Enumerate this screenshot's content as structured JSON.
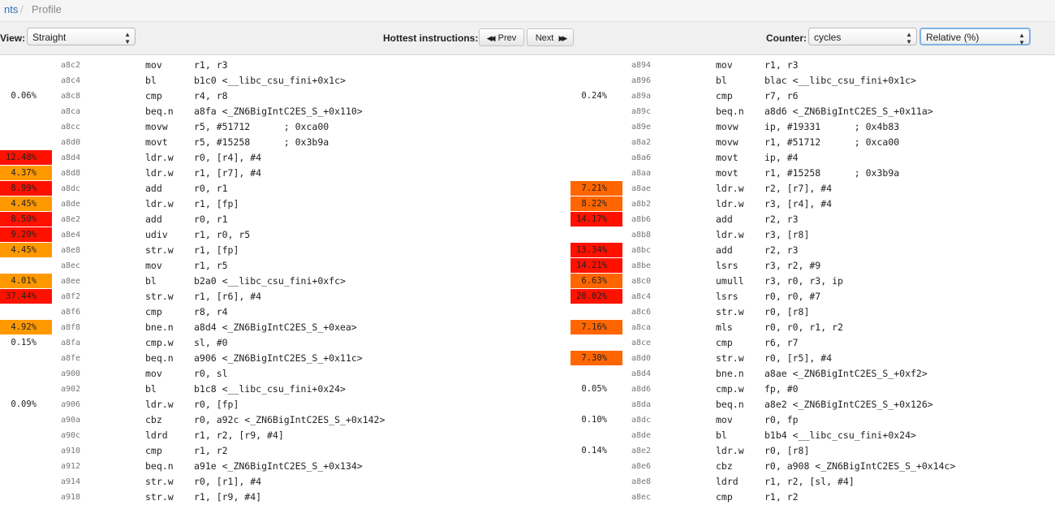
{
  "breadcrumb": {
    "parent": "nts",
    "separator": "/",
    "current": "Profile"
  },
  "toolbar": {
    "view_label": "View:",
    "view_value": "Straight",
    "hottest_label": "Hottest instructions:",
    "prev_label": "Prev",
    "next_label": "Next",
    "counter_label": "Counter:",
    "counter_value": "cycles",
    "mode_value": "Relative (%)"
  },
  "colors": {
    "hot": "#ff1100",
    "warm": "#ff6600",
    "mild": "#ff9900",
    "link": "#2a6fb8"
  },
  "left": [
    {
      "pct": "",
      "heat": "",
      "addr": "a8c2",
      "mn": "mov",
      "ops": "r1, r3"
    },
    {
      "pct": "",
      "heat": "",
      "addr": "a8c4",
      "mn": "bl",
      "ops": "b1c0 <__libc_csu_fini+0x1c>"
    },
    {
      "pct": "0.06%",
      "heat": "",
      "addr": "a8c8",
      "mn": "cmp",
      "ops": "r4, r8"
    },
    {
      "pct": "",
      "heat": "",
      "addr": "a8ca",
      "mn": "beq.n",
      "ops": "a8fa <_ZN6BigIntC2ES_S_+0x110>"
    },
    {
      "pct": "",
      "heat": "",
      "addr": "a8cc",
      "mn": "movw",
      "ops": "r5, #51712      ; 0xca00"
    },
    {
      "pct": "",
      "heat": "",
      "addr": "a8d0",
      "mn": "movt",
      "ops": "r5, #15258      ; 0x3b9a"
    },
    {
      "pct": "12.48%",
      "heat": "h1",
      "addr": "a8d4",
      "mn": "ldr.w",
      "ops": "r0, [r4], #4"
    },
    {
      "pct": "4.37%",
      "heat": "h3",
      "addr": "a8d8",
      "mn": "ldr.w",
      "ops": "r1, [r7], #4"
    },
    {
      "pct": "8.99%",
      "heat": "h1",
      "addr": "a8dc",
      "mn": "add",
      "ops": "r0, r1"
    },
    {
      "pct": "4.45%",
      "heat": "h3",
      "addr": "a8de",
      "mn": "ldr.w",
      "ops": "r1, [fp]"
    },
    {
      "pct": "8.50%",
      "heat": "h1",
      "addr": "a8e2",
      "mn": "add",
      "ops": "r0, r1"
    },
    {
      "pct": "9.20%",
      "heat": "h1",
      "addr": "a8e4",
      "mn": "udiv",
      "ops": "r1, r0, r5"
    },
    {
      "pct": "4.45%",
      "heat": "h3",
      "addr": "a8e8",
      "mn": "str.w",
      "ops": "r1, [fp]"
    },
    {
      "pct": "",
      "heat": "",
      "addr": "a8ec",
      "mn": "mov",
      "ops": "r1, r5"
    },
    {
      "pct": "4.01%",
      "heat": "h3",
      "addr": "a8ee",
      "mn": "bl",
      "ops": "b2a0 <__libc_csu_fini+0xfc>"
    },
    {
      "pct": "37.44%",
      "heat": "h1",
      "addr": "a8f2",
      "mn": "str.w",
      "ops": "r1, [r6], #4"
    },
    {
      "pct": "",
      "heat": "",
      "addr": "a8f6",
      "mn": "cmp",
      "ops": "r8, r4"
    },
    {
      "pct": "4.92%",
      "heat": "h3",
      "addr": "a8f8",
      "mn": "bne.n",
      "ops": "a8d4 <_ZN6BigIntC2ES_S_+0xea>"
    },
    {
      "pct": "0.15%",
      "heat": "",
      "addr": "a8fa",
      "mn": "cmp.w",
      "ops": "sl, #0"
    },
    {
      "pct": "",
      "heat": "",
      "addr": "a8fe",
      "mn": "beq.n",
      "ops": "a906 <_ZN6BigIntC2ES_S_+0x11c>"
    },
    {
      "pct": "",
      "heat": "",
      "addr": "a900",
      "mn": "mov",
      "ops": "r0, sl"
    },
    {
      "pct": "",
      "heat": "",
      "addr": "a902",
      "mn": "bl",
      "ops": "b1c8 <__libc_csu_fini+0x24>"
    },
    {
      "pct": "0.09%",
      "heat": "",
      "addr": "a906",
      "mn": "ldr.w",
      "ops": "r0, [fp]"
    },
    {
      "pct": "",
      "heat": "",
      "addr": "a90a",
      "mn": "cbz",
      "ops": "r0, a92c <_ZN6BigIntC2ES_S_+0x142>"
    },
    {
      "pct": "",
      "heat": "",
      "addr": "a90c",
      "mn": "ldrd",
      "ops": "r1, r2, [r9, #4]"
    },
    {
      "pct": "",
      "heat": "",
      "addr": "a910",
      "mn": "cmp",
      "ops": "r1, r2"
    },
    {
      "pct": "",
      "heat": "",
      "addr": "a912",
      "mn": "beq.n",
      "ops": "a91e <_ZN6BigIntC2ES_S_+0x134>"
    },
    {
      "pct": "",
      "heat": "",
      "addr": "a914",
      "mn": "str.w",
      "ops": "r0, [r1], #4"
    },
    {
      "pct": "",
      "heat": "",
      "addr": "a918",
      "mn": "str.w",
      "ops": "r1, [r9, #4]"
    }
  ],
  "right": [
    {
      "pct": "",
      "heat": "",
      "addr": "a894",
      "mn": "mov",
      "ops": "r1, r3"
    },
    {
      "pct": "",
      "heat": "",
      "addr": "a896",
      "mn": "bl",
      "ops": "blac <__libc_csu_fini+0x1c>"
    },
    {
      "pct": "0.24%",
      "heat": "",
      "addr": "a89a",
      "mn": "cmp",
      "ops": "r7, r6"
    },
    {
      "pct": "",
      "heat": "",
      "addr": "a89c",
      "mn": "beq.n",
      "ops": "a8d6 <_ZN6BigIntC2ES_S_+0x11a>"
    },
    {
      "pct": "",
      "heat": "",
      "addr": "a89e",
      "mn": "movw",
      "ops": "ip, #19331      ; 0x4b83"
    },
    {
      "pct": "",
      "heat": "",
      "addr": "a8a2",
      "mn": "movw",
      "ops": "r1, #51712      ; 0xca00"
    },
    {
      "pct": "",
      "heat": "",
      "addr": "a8a6",
      "mn": "movt",
      "ops": "ip, #4"
    },
    {
      "pct": "",
      "heat": "",
      "addr": "a8aa",
      "mn": "movt",
      "ops": "r1, #15258      ; 0x3b9a"
    },
    {
      "pct": "7.21%",
      "heat": "h2",
      "addr": "a8ae",
      "mn": "ldr.w",
      "ops": "r2, [r7], #4"
    },
    {
      "pct": "8.22%",
      "heat": "h2",
      "addr": "a8b2",
      "mn": "ldr.w",
      "ops": "r3, [r4], #4"
    },
    {
      "pct": "14.17%",
      "heat": "h1",
      "addr": "a8b6",
      "mn": "add",
      "ops": "r2, r3"
    },
    {
      "pct": "",
      "heat": "",
      "addr": "a8b8",
      "mn": "ldr.w",
      "ops": "r3, [r8]"
    },
    {
      "pct": "13.34%",
      "heat": "h1",
      "addr": "a8bc",
      "mn": "add",
      "ops": "r2, r3"
    },
    {
      "pct": "14.21%",
      "heat": "h1",
      "addr": "a8be",
      "mn": "lsrs",
      "ops": "r3, r2, #9"
    },
    {
      "pct": "6.63%",
      "heat": "h2",
      "addr": "a8c0",
      "mn": "umull",
      "ops": "r3, r0, r3, ip"
    },
    {
      "pct": "20.02%",
      "heat": "h1",
      "addr": "a8c4",
      "mn": "lsrs",
      "ops": "r0, r0, #7"
    },
    {
      "pct": "",
      "heat": "",
      "addr": "a8c6",
      "mn": "str.w",
      "ops": "r0, [r8]"
    },
    {
      "pct": "7.16%",
      "heat": "h2",
      "addr": "a8ca",
      "mn": "mls",
      "ops": "r0, r0, r1, r2"
    },
    {
      "pct": "",
      "heat": "",
      "addr": "a8ce",
      "mn": "cmp",
      "ops": "r6, r7"
    },
    {
      "pct": "7.30%",
      "heat": "h2",
      "addr": "a8d0",
      "mn": "str.w",
      "ops": "r0, [r5], #4"
    },
    {
      "pct": "",
      "heat": "",
      "addr": "a8d4",
      "mn": "bne.n",
      "ops": "a8ae <_ZN6BigIntC2ES_S_+0xf2>"
    },
    {
      "pct": "0.05%",
      "heat": "",
      "addr": "a8d6",
      "mn": "cmp.w",
      "ops": "fp, #0"
    },
    {
      "pct": "",
      "heat": "",
      "addr": "a8da",
      "mn": "beq.n",
      "ops": "a8e2 <_ZN6BigIntC2ES_S_+0x126>"
    },
    {
      "pct": "0.10%",
      "heat": "",
      "addr": "a8dc",
      "mn": "mov",
      "ops": "r0, fp"
    },
    {
      "pct": "",
      "heat": "",
      "addr": "a8de",
      "mn": "bl",
      "ops": "b1b4 <__libc_csu_fini+0x24>"
    },
    {
      "pct": "0.14%",
      "heat": "",
      "addr": "a8e2",
      "mn": "ldr.w",
      "ops": "r0, [r8]"
    },
    {
      "pct": "",
      "heat": "",
      "addr": "a8e6",
      "mn": "cbz",
      "ops": "r0, a908 <_ZN6BigIntC2ES_S_+0x14c>"
    },
    {
      "pct": "",
      "heat": "",
      "addr": "a8e8",
      "mn": "ldrd",
      "ops": "r1, r2, [sl, #4]"
    },
    {
      "pct": "",
      "heat": "",
      "addr": "a8ec",
      "mn": "cmp",
      "ops": "r1, r2"
    }
  ]
}
